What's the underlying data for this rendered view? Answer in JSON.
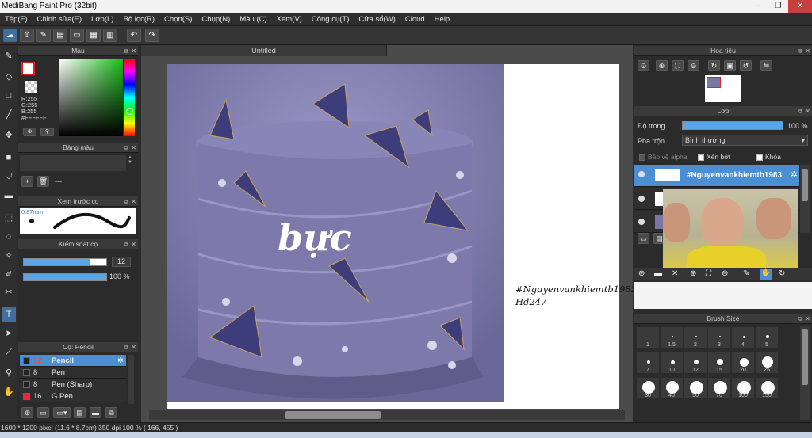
{
  "window": {
    "title": "MediBang Paint Pro (32bit)",
    "minimize": "–",
    "restore": "❐",
    "close": "✕"
  },
  "menu": [
    "Tệp(F)",
    "Chỉnh sửa(E)",
    "Lớp(L)",
    "Bộ lọc(R)",
    "Chọn(S)",
    "Chụp(N)",
    "Màu (C)",
    "Xem(V)",
    "Công cụ(T)",
    "Cửa sổ(W)",
    "Cloud",
    "Help"
  ],
  "document": {
    "tab": "Untitled",
    "text_overlay": "bực",
    "caption_line1": "#Nguyenvankhiemtb1983",
    "caption_line2": "Hd247"
  },
  "color_panel": {
    "title": "Màu",
    "r": "R:255",
    "g": "G:255",
    "b": "B:255",
    "hex": "#FFFFFF"
  },
  "palette_panel": {
    "title": "Bảng màu",
    "entry": "---"
  },
  "brush_preview_panel": {
    "title": "Xem trước cọ",
    "size": "0.87mm"
  },
  "brush_control_panel": {
    "title": "Kiểm soát cọ",
    "size_value": "12",
    "size_fraction": 0.8,
    "opacity_value": "100 %",
    "opacity_fraction": 1.0
  },
  "brush_list_panel": {
    "title": "Cọ: Pencil",
    "brushes": [
      {
        "size": "12",
        "name": "Pencil",
        "selected": true
      },
      {
        "size": "8",
        "name": "Pen",
        "selected": false
      },
      {
        "size": "8",
        "name": "Pen (Sharp)",
        "selected": false
      },
      {
        "size": "16",
        "name": "G Pen",
        "selected": false
      }
    ]
  },
  "navigator_panel": {
    "title": "Hoa tiêu"
  },
  "layer_panel": {
    "title": "Lớp",
    "opacity_label": "Độ trong",
    "opacity_value": "100 %",
    "opacity_fraction": 1.0,
    "blend_label": "Pha trộn",
    "blend_value": "Bình thường",
    "protect_alpha": "Bảo vệ alpha",
    "clipping": "Xén bớt",
    "lock": "Khóa",
    "layer_name": "#Nguyenvankhiemtb1983"
  },
  "brush_size_panel": {
    "title": "Brush Size",
    "sizes": [
      "1",
      "1.5",
      "2",
      "3",
      "4",
      "5",
      "7",
      "10",
      "12",
      "15",
      "20",
      "25",
      "30",
      "40",
      "50",
      "70",
      "100",
      "150"
    ]
  },
  "status": {
    "text": "1600 * 1200 pixel   (11.6 * 8.7cm)   350 dpi   100 %   ( 166, 455 )"
  }
}
